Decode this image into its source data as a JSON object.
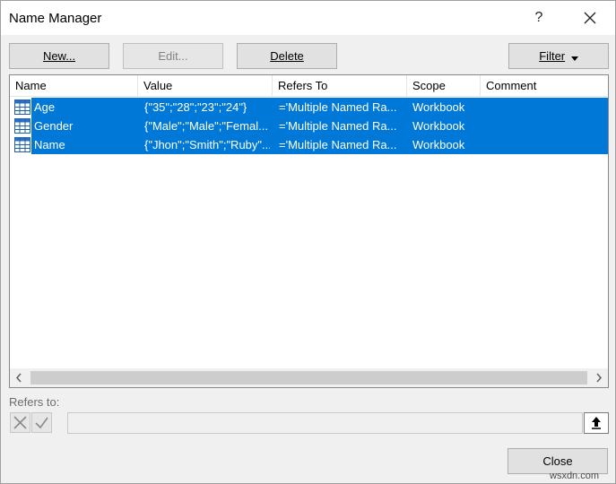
{
  "dialog": {
    "title": "Name Manager",
    "help": "?"
  },
  "toolbar": {
    "new_label": "New...",
    "edit_label": "Edit...",
    "delete_label": "Delete",
    "filter_label": "Filter"
  },
  "columns": [
    "Name",
    "Value",
    "Refers To",
    "Scope",
    "Comment"
  ],
  "rows": [
    {
      "name": "Age",
      "value": "{\"35\";\"28\";\"23\";\"24\"}",
      "refers_to": "='Multiple Named Ra...",
      "scope": "Workbook",
      "comment": ""
    },
    {
      "name": "Gender",
      "value": "{\"Male\";\"Male\";\"Femal...",
      "refers_to": "='Multiple Named Ra...",
      "scope": "Workbook",
      "comment": ""
    },
    {
      "name": "Name",
      "value": "{\"Jhon\";\"Smith\";\"Ruby\"...",
      "refers_to": "='Multiple Named Ra...",
      "scope": "Workbook",
      "comment": ""
    }
  ],
  "refers": {
    "label": "Refers to:",
    "value": ""
  },
  "footer": {
    "close_label": "Close",
    "watermark": "wsxdn.com"
  },
  "colors": {
    "selection": "#0078d7",
    "dialog_bg": "#f0f0f0"
  },
  "icons": {
    "row": "named-range-grid-icon",
    "cancel": "cancel-x-icon",
    "confirm": "checkmark-icon",
    "collapse": "collapse-dialog-icon",
    "close": "close-icon"
  }
}
